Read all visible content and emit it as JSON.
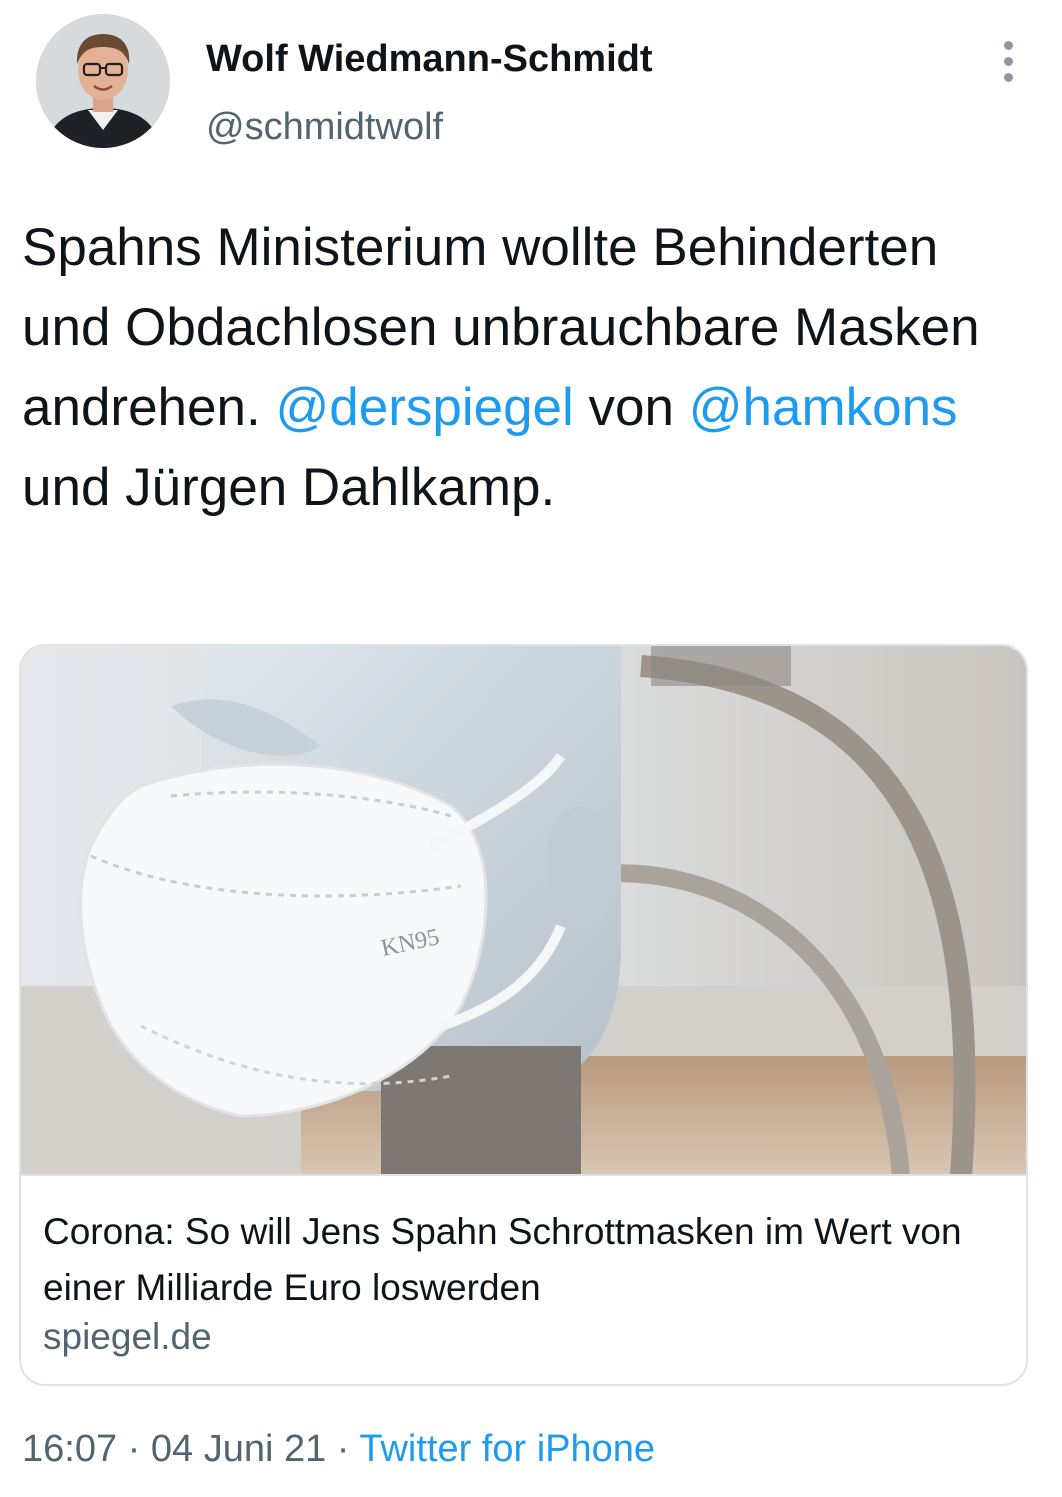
{
  "author": {
    "display_name": "Wolf Wiedmann-Schmidt",
    "handle": "@schmidtwolf",
    "avatar_icon": "profile-photo"
  },
  "more_icon": "more-vertical-icon",
  "tweet": {
    "text_part1": "Spahns Ministerium wollte Behinderten und Obdachlosen unbrauchbare Masken andrehen. ",
    "mention1": "@derspiegel",
    "text_part2": " von ",
    "mention2": "@hamkons",
    "text_part3": " und Jürgen Dahlkamp."
  },
  "card": {
    "image_label": "KN95",
    "title": "Corona: So will Jens Spahn Schrottmasken im Wert von einer Milliarde Euro loswerden",
    "domain": "spiegel.de"
  },
  "meta": {
    "time": "16:07",
    "sep1": " · ",
    "date": "04 Juni 21",
    "sep2": " · ",
    "source": "Twitter for iPhone"
  },
  "colors": {
    "link": "#1d9bf0",
    "secondary_text": "#536471",
    "primary_text": "#0f1419",
    "border": "#dfe3e6"
  }
}
